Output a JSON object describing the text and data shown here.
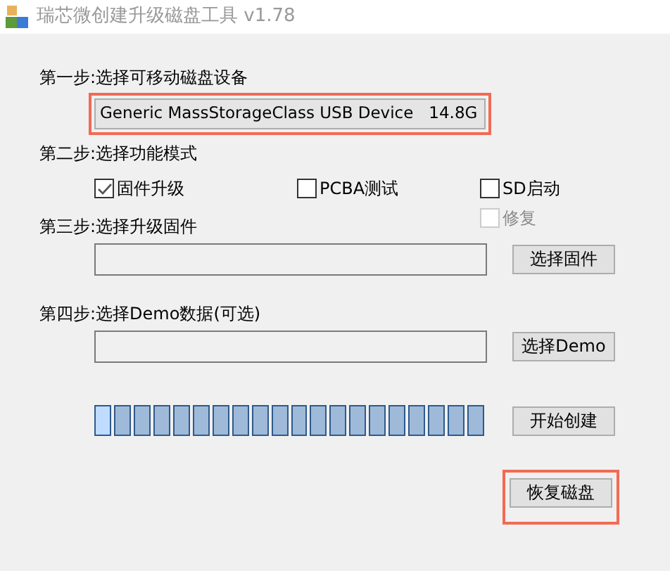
{
  "window": {
    "title": "瑞芯微创建升级磁盘工具 v1.78"
  },
  "step1": {
    "label": "第一步:选择可移动磁盘设备",
    "device": "Generic MassStorageClass USB Device   14.8G",
    "highlighted": true
  },
  "step2": {
    "label": "第二步:选择功能模式",
    "options": [
      {
        "label": "固件升级",
        "checked": true,
        "disabled": false
      },
      {
        "label": "PCBA测试",
        "checked": false,
        "disabled": false
      },
      {
        "label": "SD启动",
        "checked": false,
        "disabled": false
      },
      {
        "label": "修复",
        "checked": false,
        "disabled": true
      }
    ]
  },
  "step3": {
    "label": "第三步:选择升级固件",
    "button": "选择固件"
  },
  "step4": {
    "label": "第四步:选择Demo数据(可选)",
    "button": "选择Demo"
  },
  "progress": {
    "level": 1
  },
  "start_button": {
    "label": "开始创建"
  },
  "restore_button": {
    "label": "恢复磁盘",
    "highlighted": true
  }
}
